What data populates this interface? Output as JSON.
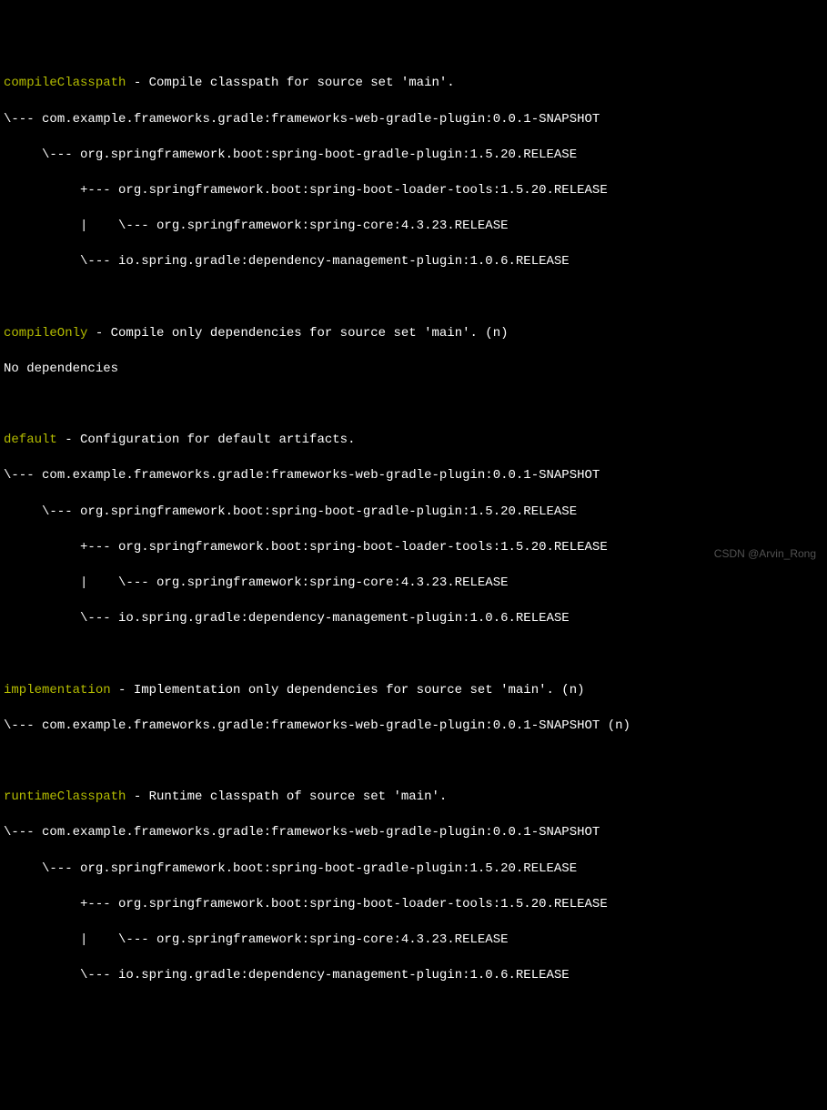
{
  "sections": {
    "compileClasspath": {
      "name": "compileClasspath",
      "desc": " - Compile classpath for source set 'main'.",
      "tree": [
        {
          "prefix": "\\--- ",
          "text": "com.example.frameworks.gradle:frameworks-web-gradle-plugin:0.0.1-SNAPSHOT"
        },
        {
          "prefix": "     \\--- ",
          "text": "org.springframework.boot:spring-boot-gradle-plugin:1.5.20.RELEASE"
        },
        {
          "prefix": "          +--- ",
          "text": "org.springframework.boot:spring-boot-loader-tools:1.5.20.RELEASE"
        },
        {
          "prefix": "          |    \\--- ",
          "text": "org.springframework:spring-core:4.3.23.RELEASE"
        },
        {
          "prefix": "          \\--- ",
          "text": "io.spring.gradle:dependency-management-plugin:1.0.6.RELEASE"
        }
      ]
    },
    "compileOnly": {
      "name": "compileOnly",
      "desc": " - Compile only dependencies for source set 'main'. (n)",
      "noDeps": "No dependencies"
    },
    "default": {
      "name": "default",
      "desc": " - Configuration for default artifacts.",
      "tree": [
        {
          "prefix": "\\--- ",
          "text": "com.example.frameworks.gradle:frameworks-web-gradle-plugin:0.0.1-SNAPSHOT"
        },
        {
          "prefix": "     \\--- ",
          "text": "org.springframework.boot:spring-boot-gradle-plugin:1.5.20.RELEASE"
        },
        {
          "prefix": "          +--- ",
          "text": "org.springframework.boot:spring-boot-loader-tools:1.5.20.RELEASE"
        },
        {
          "prefix": "          |    \\--- ",
          "text": "org.springframework:spring-core:4.3.23.RELEASE"
        },
        {
          "prefix": "          \\--- ",
          "text": "io.spring.gradle:dependency-management-plugin:1.0.6.RELEASE"
        }
      ]
    },
    "implementation": {
      "name": "implementation",
      "desc": " - Implementation only dependencies for source set 'main'. (n)",
      "tree": [
        {
          "prefix": "\\--- ",
          "text": "com.example.frameworks.gradle:frameworks-web-gradle-plugin:0.0.1-SNAPSHOT (n)"
        }
      ]
    },
    "runtimeClasspath": {
      "name": "runtimeClasspath",
      "desc": " - Runtime classpath of source set 'main'.",
      "tree": [
        {
          "prefix": "\\--- ",
          "text": "com.example.frameworks.gradle:frameworks-web-gradle-plugin:0.0.1-SNAPSHOT"
        },
        {
          "prefix": "     \\--- ",
          "text": "org.springframework.boot:spring-boot-gradle-plugin:1.5.20.RELEASE"
        },
        {
          "prefix": "          +--- ",
          "text": "org.springframework.boot:spring-boot-loader-tools:1.5.20.RELEASE"
        },
        {
          "prefix": "          |    \\--- ",
          "text": "org.springframework:spring-core:4.3.23.RELEASE"
        },
        {
          "prefix": "          \\--- ",
          "text": "io.spring.gradle:dependency-management-plugin:1.0.6.RELEASE"
        }
      ]
    }
  },
  "watermark": "CSDN @Arvin_Rong"
}
